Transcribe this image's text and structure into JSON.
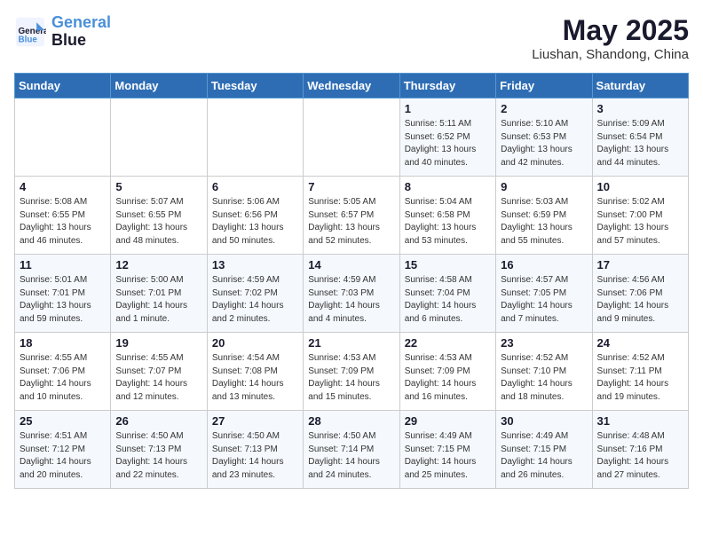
{
  "header": {
    "logo_line1": "General",
    "logo_line2": "Blue",
    "month": "May 2025",
    "location": "Liushan, Shandong, China"
  },
  "days_of_week": [
    "Sunday",
    "Monday",
    "Tuesday",
    "Wednesday",
    "Thursday",
    "Friday",
    "Saturday"
  ],
  "weeks": [
    [
      {
        "day": "",
        "info": ""
      },
      {
        "day": "",
        "info": ""
      },
      {
        "day": "",
        "info": ""
      },
      {
        "day": "",
        "info": ""
      },
      {
        "day": "1",
        "info": "Sunrise: 5:11 AM\nSunset: 6:52 PM\nDaylight: 13 hours\nand 40 minutes."
      },
      {
        "day": "2",
        "info": "Sunrise: 5:10 AM\nSunset: 6:53 PM\nDaylight: 13 hours\nand 42 minutes."
      },
      {
        "day": "3",
        "info": "Sunrise: 5:09 AM\nSunset: 6:54 PM\nDaylight: 13 hours\nand 44 minutes."
      }
    ],
    [
      {
        "day": "4",
        "info": "Sunrise: 5:08 AM\nSunset: 6:55 PM\nDaylight: 13 hours\nand 46 minutes."
      },
      {
        "day": "5",
        "info": "Sunrise: 5:07 AM\nSunset: 6:55 PM\nDaylight: 13 hours\nand 48 minutes."
      },
      {
        "day": "6",
        "info": "Sunrise: 5:06 AM\nSunset: 6:56 PM\nDaylight: 13 hours\nand 50 minutes."
      },
      {
        "day": "7",
        "info": "Sunrise: 5:05 AM\nSunset: 6:57 PM\nDaylight: 13 hours\nand 52 minutes."
      },
      {
        "day": "8",
        "info": "Sunrise: 5:04 AM\nSunset: 6:58 PM\nDaylight: 13 hours\nand 53 minutes."
      },
      {
        "day": "9",
        "info": "Sunrise: 5:03 AM\nSunset: 6:59 PM\nDaylight: 13 hours\nand 55 minutes."
      },
      {
        "day": "10",
        "info": "Sunrise: 5:02 AM\nSunset: 7:00 PM\nDaylight: 13 hours\nand 57 minutes."
      }
    ],
    [
      {
        "day": "11",
        "info": "Sunrise: 5:01 AM\nSunset: 7:01 PM\nDaylight: 13 hours\nand 59 minutes."
      },
      {
        "day": "12",
        "info": "Sunrise: 5:00 AM\nSunset: 7:01 PM\nDaylight: 14 hours\nand 1 minute."
      },
      {
        "day": "13",
        "info": "Sunrise: 4:59 AM\nSunset: 7:02 PM\nDaylight: 14 hours\nand 2 minutes."
      },
      {
        "day": "14",
        "info": "Sunrise: 4:59 AM\nSunset: 7:03 PM\nDaylight: 14 hours\nand 4 minutes."
      },
      {
        "day": "15",
        "info": "Sunrise: 4:58 AM\nSunset: 7:04 PM\nDaylight: 14 hours\nand 6 minutes."
      },
      {
        "day": "16",
        "info": "Sunrise: 4:57 AM\nSunset: 7:05 PM\nDaylight: 14 hours\nand 7 minutes."
      },
      {
        "day": "17",
        "info": "Sunrise: 4:56 AM\nSunset: 7:06 PM\nDaylight: 14 hours\nand 9 minutes."
      }
    ],
    [
      {
        "day": "18",
        "info": "Sunrise: 4:55 AM\nSunset: 7:06 PM\nDaylight: 14 hours\nand 10 minutes."
      },
      {
        "day": "19",
        "info": "Sunrise: 4:55 AM\nSunset: 7:07 PM\nDaylight: 14 hours\nand 12 minutes."
      },
      {
        "day": "20",
        "info": "Sunrise: 4:54 AM\nSunset: 7:08 PM\nDaylight: 14 hours\nand 13 minutes."
      },
      {
        "day": "21",
        "info": "Sunrise: 4:53 AM\nSunset: 7:09 PM\nDaylight: 14 hours\nand 15 minutes."
      },
      {
        "day": "22",
        "info": "Sunrise: 4:53 AM\nSunset: 7:09 PM\nDaylight: 14 hours\nand 16 minutes."
      },
      {
        "day": "23",
        "info": "Sunrise: 4:52 AM\nSunset: 7:10 PM\nDaylight: 14 hours\nand 18 minutes."
      },
      {
        "day": "24",
        "info": "Sunrise: 4:52 AM\nSunset: 7:11 PM\nDaylight: 14 hours\nand 19 minutes."
      }
    ],
    [
      {
        "day": "25",
        "info": "Sunrise: 4:51 AM\nSunset: 7:12 PM\nDaylight: 14 hours\nand 20 minutes."
      },
      {
        "day": "26",
        "info": "Sunrise: 4:50 AM\nSunset: 7:13 PM\nDaylight: 14 hours\nand 22 minutes."
      },
      {
        "day": "27",
        "info": "Sunrise: 4:50 AM\nSunset: 7:13 PM\nDaylight: 14 hours\nand 23 minutes."
      },
      {
        "day": "28",
        "info": "Sunrise: 4:50 AM\nSunset: 7:14 PM\nDaylight: 14 hours\nand 24 minutes."
      },
      {
        "day": "29",
        "info": "Sunrise: 4:49 AM\nSunset: 7:15 PM\nDaylight: 14 hours\nand 25 minutes."
      },
      {
        "day": "30",
        "info": "Sunrise: 4:49 AM\nSunset: 7:15 PM\nDaylight: 14 hours\nand 26 minutes."
      },
      {
        "day": "31",
        "info": "Sunrise: 4:48 AM\nSunset: 7:16 PM\nDaylight: 14 hours\nand 27 minutes."
      }
    ]
  ]
}
